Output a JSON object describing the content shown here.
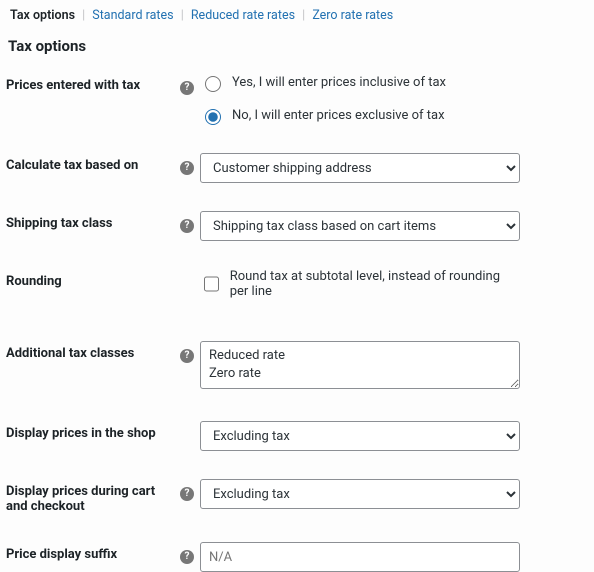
{
  "tabs": {
    "active": "Tax options",
    "standard": "Standard rates",
    "reduced": "Reduced rate rates",
    "zero": "Zero rate rates"
  },
  "title": "Tax options",
  "fields": {
    "prices_entered": {
      "label": "Prices entered with tax",
      "opt_inclusive": "Yes, I will enter prices inclusive of tax",
      "opt_exclusive": "No, I will enter prices exclusive of tax"
    },
    "calc_based": {
      "label": "Calculate tax based on",
      "value": "Customer shipping address"
    },
    "ship_class": {
      "label": "Shipping tax class",
      "value": "Shipping tax class based on cart items"
    },
    "rounding": {
      "label": "Rounding",
      "check_label": "Round tax at subtotal level, instead of rounding per line"
    },
    "additional": {
      "label": "Additional tax classes",
      "value": "Reduced rate\nZero rate"
    },
    "display_shop": {
      "label": "Display prices in the shop",
      "value": "Excluding tax"
    },
    "display_cart": {
      "label": "Display prices during cart and checkout",
      "value": "Excluding tax"
    },
    "suffix": {
      "label": "Price display suffix",
      "placeholder": "N/A"
    }
  }
}
